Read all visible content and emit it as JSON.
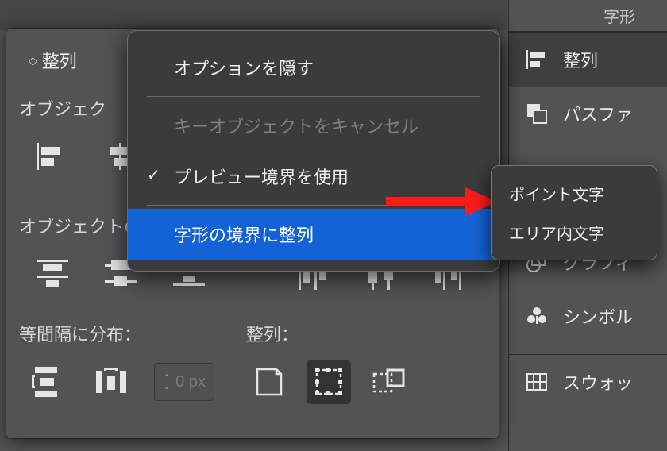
{
  "panel": {
    "tab": "整列",
    "section_align": "オブジェク",
    "section_distrib": "オブジェクトの分布：",
    "section_spacing": "等間隔に分布：",
    "section_alignto": "整列：",
    "spacing_value": "0 px"
  },
  "flyout": {
    "hide_options": "オプションを隠す",
    "cancel_key": "キーオブジェクトをキャンセル",
    "preview_bounds": "プレビュー境界を使用",
    "glyph_bounds": "字形の境界に整列"
  },
  "submenu": {
    "point_text": "ポイント文字",
    "area_text": "エリア内文字"
  },
  "side": {
    "glyphs": "字形",
    "align": "整列",
    "pathfinder": "パスファ",
    "graphic": "グラフィ",
    "symbol": "シンボル",
    "swatch": "スウォッ"
  }
}
